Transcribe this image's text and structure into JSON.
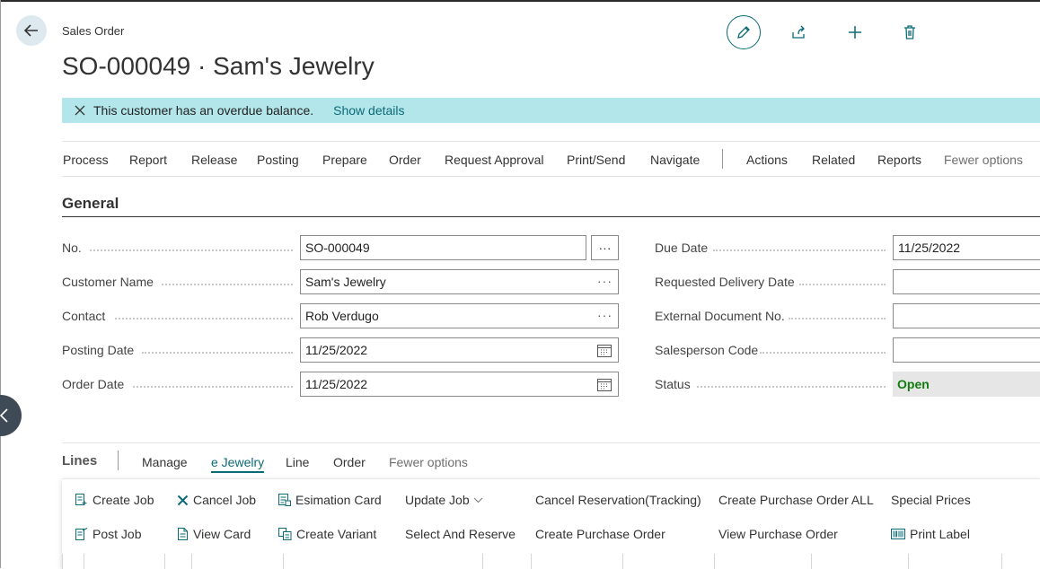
{
  "header": {
    "breadcrumb": "Sales Order",
    "title": "SO-000049 · Sam's Jewelry"
  },
  "top_actions": [
    "edit-icon",
    "share-icon",
    "plus-icon",
    "trash-icon"
  ],
  "banner": {
    "message": "This customer has an overdue balance.",
    "link": "Show details"
  },
  "actionbar": {
    "items": [
      "Process",
      "Report",
      "Release",
      "Posting",
      "Prepare",
      "Order",
      "Request Approval",
      "Print/Send",
      "Navigate"
    ],
    "secondary": [
      "Actions",
      "Related",
      "Reports"
    ],
    "fewer": "Fewer options"
  },
  "general": {
    "title": "General",
    "left_fields": [
      {
        "label": "No.",
        "value": "SO-000049"
      },
      {
        "label": "Customer Name",
        "value": "Sam's Jewelry"
      },
      {
        "label": "Contact",
        "value": "Rob Verdugo"
      },
      {
        "label": "Posting Date",
        "value": "11/25/2022"
      },
      {
        "label": "Order Date",
        "value": "11/25/2022"
      }
    ],
    "right_fields": [
      {
        "label": "Due Date",
        "value": "11/25/2022"
      },
      {
        "label": "Requested Delivery Date",
        "value": ""
      },
      {
        "label": "External Document No.",
        "value": ""
      },
      {
        "label": "Salesperson Code",
        "value": ""
      },
      {
        "label": "Status",
        "value": "Open"
      }
    ],
    "ellipsis": "···"
  },
  "lines": {
    "title": "Lines",
    "tabs": [
      "Manage",
      "e Jewelry",
      "Line",
      "Order",
      "Fewer options"
    ],
    "row1": [
      "Create Job",
      "Cancel Job",
      "Esimation Card",
      "Update Job",
      "Cancel Reservation(Tracking)",
      "Create Purchase Order ALL",
      "Special Prices"
    ],
    "row2": [
      "Post Job",
      "View Card",
      "Create Variant",
      "Select And Reserve",
      "Create Purchase Order",
      "View Purchase Order",
      "Print Label"
    ]
  },
  "colors": {
    "accent": "#0b6a76",
    "banner": "#b3e6ea",
    "status_open": "#107c10"
  }
}
